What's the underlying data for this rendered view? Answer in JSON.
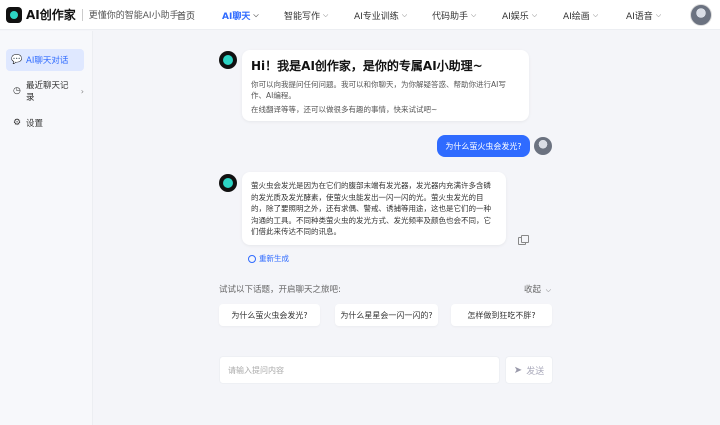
{
  "header": {
    "logo_text": "AI创作家",
    "slogan": "更懂你的智能AI小助手",
    "nav": [
      {
        "label": "首页",
        "has_chevron": false,
        "active": false
      },
      {
        "label": "AI聊天",
        "has_chevron": true,
        "active": true
      },
      {
        "label": "智能写作",
        "has_chevron": true,
        "active": false
      },
      {
        "label": "AI专业训练",
        "has_chevron": true,
        "active": false
      },
      {
        "label": "代码助手",
        "has_chevron": true,
        "active": false
      },
      {
        "label": "AI娱乐",
        "has_chevron": true,
        "active": false
      },
      {
        "label": "AI绘画",
        "has_chevron": true,
        "active": false
      },
      {
        "label": "AI语音",
        "has_chevron": true,
        "active": false
      }
    ]
  },
  "sidebar": {
    "items": [
      {
        "label": "AI聊天对话",
        "icon": "chat-icon",
        "active": true
      },
      {
        "label": "最近聊天记录",
        "icon": "clock-icon",
        "active": false
      },
      {
        "label": "设置",
        "icon": "gear-icon",
        "active": false
      }
    ]
  },
  "chat": {
    "welcome_title": "Hi！我是AI创作家，是你的专属AI小助理~",
    "welcome_line1": "你可以向我提问任何问题。我可以和你聊天，为你解疑答惑、帮助你进行AI写",
    "welcome_line2": "作、AI编程。",
    "welcome_line3": "在线翻译等等，还可以做很多有趣的事情，快来试试吧~",
    "user_question": "为什么萤火虫会发光?",
    "answer_lines": [
      "萤火虫会发光是因为在它们的腹部末端有发光器，发光器内充满许多含磷",
      "的发光质及发光酵素，使萤火虫能发出一闪一闪的光。萤火虫发光的目",
      "的，除了要照明之外，还有求偶、警戒、诱捕等用途，这也是它们的一种",
      "沟通的工具。不同种类萤火虫的发光方式、发光频率及颜色也会不同，它",
      "们借此来传达不同的讯息。"
    ],
    "regenerate_label": "重新生成"
  },
  "topics": {
    "title": "试试以下话题，开启聊天之旅吧:",
    "collapse_label": "收起",
    "items": [
      "为什么萤火虫会发光?",
      "为什么星星会一闪一闪的?",
      "怎样做到狂吃不胖?"
    ]
  },
  "input": {
    "placeholder": "请输入提问内容",
    "send_label": "发送"
  }
}
